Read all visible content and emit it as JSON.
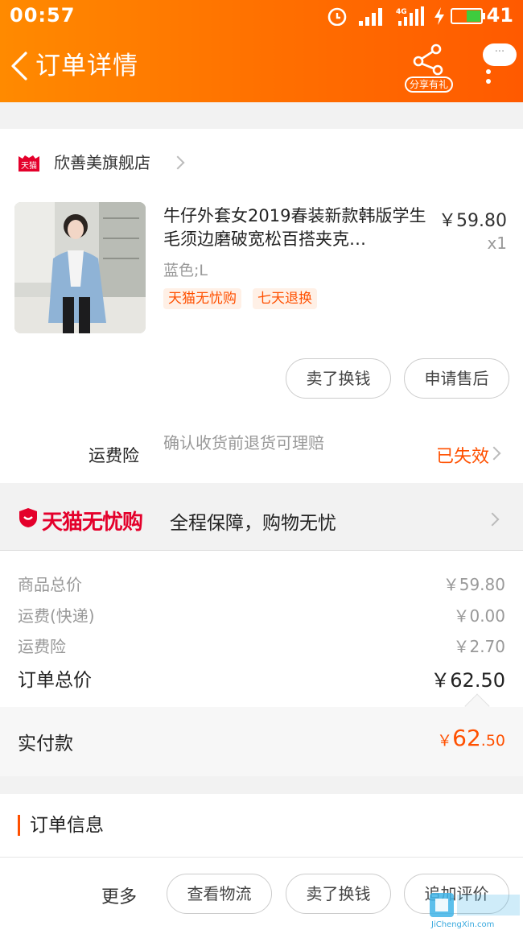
{
  "status_bar": {
    "time": "00:57",
    "network": "4G",
    "battery": "41"
  },
  "nav": {
    "title": "订单详情",
    "share_label": "分享有礼",
    "bubble": "···"
  },
  "store": {
    "platform_badge": "天猫",
    "name": "欣善美旗舰店"
  },
  "product": {
    "title": "牛仔外套女2019春装新款韩版学生毛须边磨破宽松百搭夹克…",
    "price": "￥59.80",
    "quantity": "x1",
    "sku": "蓝色;L",
    "tags": [
      "天猫无忧购",
      "七天退换"
    ]
  },
  "item_actions": {
    "sell": "卖了换钱",
    "after_sale": "申请售后"
  },
  "shipping_insurance": {
    "label": "运费险",
    "desc": "确认收货前退货可理赔",
    "status": "已失效"
  },
  "wuyou": {
    "name": "天猫无忧购",
    "desc": "全程保障，购物无忧"
  },
  "price_summary": [
    {
      "label": "商品总价",
      "value": "￥59.80"
    },
    {
      "label": "运费(快递)",
      "value": "￥0.00"
    },
    {
      "label": "运费险",
      "value": "￥2.70"
    }
  ],
  "order_total": {
    "label": "订单总价",
    "value": "￥62.50"
  },
  "paid": {
    "label": "实付款",
    "currency": "￥",
    "integer": "62",
    "decimal": ".50"
  },
  "order_info": {
    "title": "订单信息"
  },
  "bottom_bar": {
    "more": "更多",
    "logistics": "查看物流",
    "sell": "卖了换钱",
    "review": "追加评价"
  },
  "watermark": {
    "text": "JiChengXin.com"
  },
  "colors": {
    "accent": "#ff5000",
    "header": "#ff7a00",
    "tmall_red": "#e4002b"
  }
}
